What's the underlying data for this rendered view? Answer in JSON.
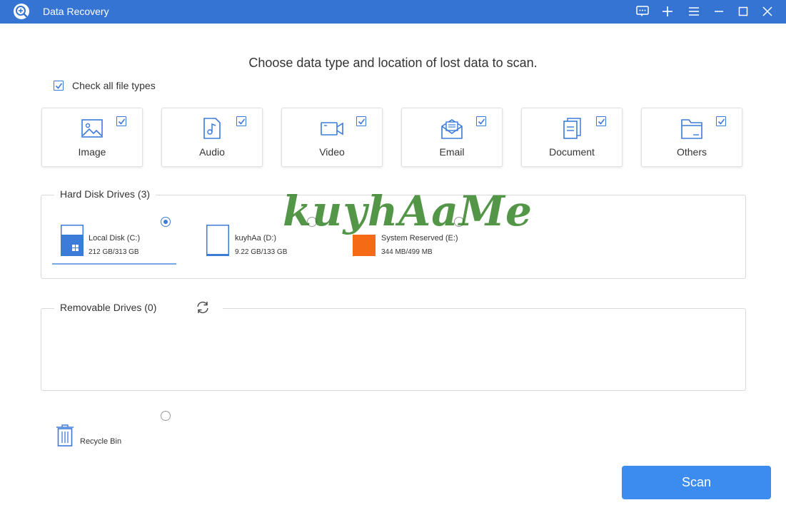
{
  "window": {
    "title": "Data Recovery",
    "controls": [
      "feedback-icon",
      "plus-icon",
      "menu-icon",
      "minimize-icon",
      "maximize-icon",
      "close-icon"
    ]
  },
  "heading": "Choose data type and location of lost data to scan.",
  "check_all": {
    "label": "Check all file types",
    "checked": true
  },
  "file_types": [
    {
      "label": "Image",
      "icon": "image-icon",
      "checked": true
    },
    {
      "label": "Audio",
      "icon": "audio-icon",
      "checked": true
    },
    {
      "label": "Video",
      "icon": "video-icon",
      "checked": true
    },
    {
      "label": "Email",
      "icon": "email-icon",
      "checked": true
    },
    {
      "label": "Document",
      "icon": "document-icon",
      "checked": true
    },
    {
      "label": "Others",
      "icon": "folder-icon",
      "checked": true
    }
  ],
  "hard_disk": {
    "title": "Hard Disk Drives (3)",
    "drives": [
      {
        "name": "Local Disk (C:)",
        "size": "212 GB/313 GB",
        "selected": true,
        "used_fraction": 0.68
      },
      {
        "name": "kuyhAa (D:)",
        "size": "9.22 GB/133 GB",
        "selected": false,
        "used_fraction": 0.07
      },
      {
        "name": "System Reserved (E:)",
        "size": "344 MB/499 MB",
        "selected": false,
        "used_fraction": 0.69
      }
    ]
  },
  "removable": {
    "title": "Removable Drives (0)"
  },
  "recycle_bin": {
    "label": "Recycle Bin",
    "selected": false
  },
  "scan_button": "Scan",
  "watermark": "kuyhAaMe",
  "colors": {
    "accent": "#3574d2",
    "button": "#3c8cf0",
    "system_drive": "#f56a14"
  }
}
